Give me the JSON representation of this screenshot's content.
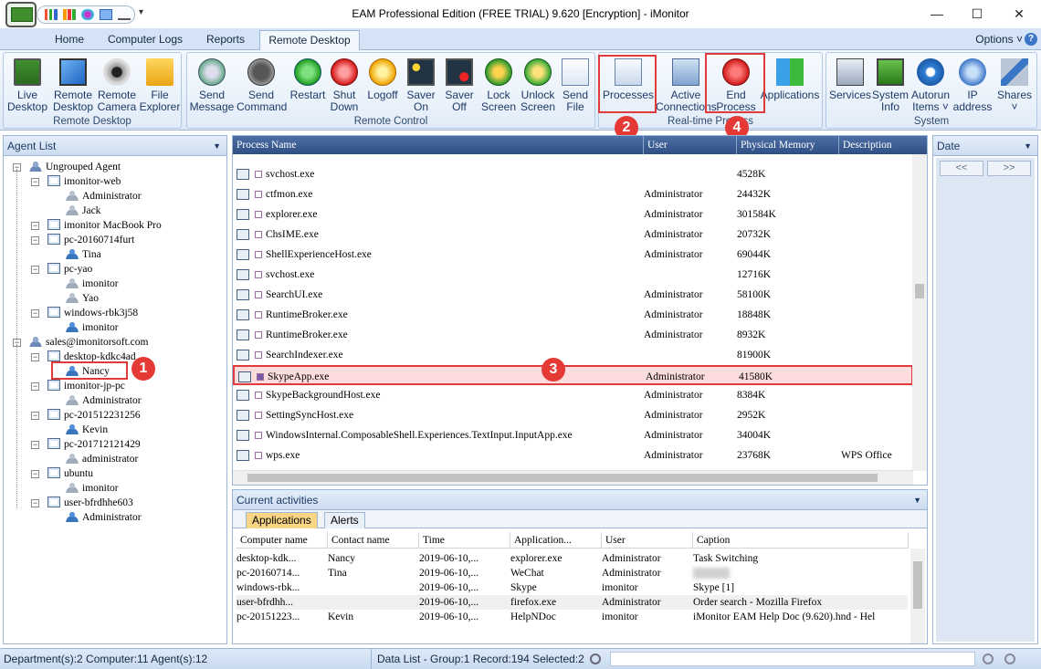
{
  "window": {
    "title": "EAM Professional Edition (FREE TRIAL) 9.620 [Encryption] - iMonitor",
    "min_glyph": "—",
    "max_glyph": "☐",
    "close_glyph": "✕",
    "qat_dropdown_glyph": "▾"
  },
  "tabs": [
    "Home",
    "Computer Logs",
    "Reports",
    "Remote Desktop"
  ],
  "active_tab": "Remote Desktop",
  "options_label": "Options ˅",
  "help_glyph": "?",
  "ribbon": {
    "groups": [
      {
        "label": "Remote Desktop",
        "buttons": [
          {
            "line1": "Live",
            "line2": "Desktop",
            "icon": "monitor-icon"
          },
          {
            "line1": "Remote",
            "line2": "Desktop",
            "icon": "remote-desktop-icon"
          },
          {
            "line1": "Remote",
            "line2": "Camera",
            "icon": "webcam-icon"
          },
          {
            "line1": "File",
            "line2": "Explorer",
            "icon": "folder-icon"
          }
        ]
      },
      {
        "label": "Remote Control",
        "buttons": [
          {
            "line1": "Send",
            "line2": "Message",
            "icon": "message-icon"
          },
          {
            "line1": "Send",
            "line2": "Command",
            "icon": "command-icon"
          },
          {
            "line1": "Restart",
            "line2": "",
            "icon": "restart-icon"
          },
          {
            "line1": "Shut",
            "line2": "Down",
            "icon": "power-icon"
          },
          {
            "line1": "Logoff",
            "line2": "",
            "icon": "key-icon"
          },
          {
            "line1": "Saver",
            "line2": "On",
            "icon": "screensaver-on-icon"
          },
          {
            "line1": "Saver",
            "line2": "Off",
            "icon": "screensaver-off-icon"
          },
          {
            "line1": "Lock",
            "line2": "Screen",
            "icon": "lock-screen-icon"
          },
          {
            "line1": "Unlock",
            "line2": "Screen",
            "icon": "unlock-screen-icon"
          },
          {
            "line1": "Send",
            "line2": "File",
            "icon": "send-file-icon"
          }
        ]
      },
      {
        "label": "Real-time Process",
        "buttons": [
          {
            "line1": "Processes",
            "line2": "",
            "icon": "processes-icon"
          },
          {
            "line1": "Active",
            "line2": "Connections",
            "icon": "connections-icon"
          },
          {
            "line1": "End",
            "line2": "Process",
            "icon": "end-process-icon"
          },
          {
            "line1": "Applications",
            "line2": "",
            "icon": "applications-icon"
          }
        ]
      },
      {
        "label": "System",
        "buttons": [
          {
            "line1": "Services",
            "line2": "",
            "icon": "services-icon"
          },
          {
            "line1": "System",
            "line2": "Info",
            "icon": "system-info-icon"
          },
          {
            "line1": "Autorun",
            "line2": "Items ˅",
            "icon": "autorun-icon"
          },
          {
            "line1": "IP",
            "line2": "address",
            "icon": "ip-icon"
          },
          {
            "line1": "Shares",
            "line2": "˅",
            "icon": "shares-icon"
          }
        ]
      }
    ]
  },
  "callouts": [
    "1",
    "2",
    "3",
    "4"
  ],
  "agent_list": {
    "title": "Agent List",
    "dropdown_glyph": "▼",
    "nodes": [
      {
        "label": "Ungrouped Agent",
        "type": "group",
        "level": 0
      },
      {
        "label": "imonitor-web",
        "type": "pc",
        "level": 1
      },
      {
        "label": "Administrator",
        "type": "userg",
        "level": 2
      },
      {
        "label": "Jack",
        "type": "userg",
        "level": 2
      },
      {
        "label": "imonitor  MacBook Pro",
        "type": "pc",
        "level": 1
      },
      {
        "label": "pc-20160714furt",
        "type": "pc",
        "level": 1
      },
      {
        "label": "Tina",
        "type": "user",
        "level": 2
      },
      {
        "label": "pc-yao",
        "type": "pc",
        "level": 1
      },
      {
        "label": "imonitor",
        "type": "userg",
        "level": 2
      },
      {
        "label": "Yao",
        "type": "userg",
        "level": 2
      },
      {
        "label": "windows-rbk3j58",
        "type": "pc",
        "level": 1
      },
      {
        "label": "imonitor",
        "type": "user",
        "level": 2
      },
      {
        "label": "sales@imonitorsoft.com",
        "type": "group",
        "level": 0
      },
      {
        "label": "desktop-kdkc4ad",
        "type": "pc",
        "level": 1
      },
      {
        "label": "Nancy",
        "type": "user",
        "level": 2
      },
      {
        "label": "imonitor-jp-pc",
        "type": "pc",
        "level": 1
      },
      {
        "label": "Administrator",
        "type": "userg",
        "level": 2
      },
      {
        "label": "pc-201512231256",
        "type": "pc",
        "level": 1
      },
      {
        "label": "Kevin",
        "type": "user",
        "level": 2
      },
      {
        "label": "pc-201712121429",
        "type": "pc",
        "level": 1
      },
      {
        "label": "administrator",
        "type": "userg",
        "level": 2
      },
      {
        "label": "ubuntu",
        "type": "pc",
        "level": 1
      },
      {
        "label": "imonitor",
        "type": "userg",
        "level": 2
      },
      {
        "label": "user-bfrdhhe603",
        "type": "pc",
        "level": 1
      },
      {
        "label": "Administrator",
        "type": "user",
        "level": 2
      }
    ]
  },
  "process_list": {
    "columns": [
      "Process Name",
      "User",
      "Physical Memory",
      "Description"
    ],
    "rows": [
      {
        "name": "svchost.exe",
        "user": "",
        "mem": "4528K",
        "desc": ""
      },
      {
        "name": "ctfmon.exe",
        "user": "Administrator",
        "mem": "24432K",
        "desc": ""
      },
      {
        "name": "explorer.exe",
        "user": "Administrator",
        "mem": "301584K",
        "desc": ""
      },
      {
        "name": "ChsIME.exe",
        "user": "Administrator",
        "mem": "20732K",
        "desc": ""
      },
      {
        "name": "ShellExperienceHost.exe",
        "user": "Administrator",
        "mem": "69044K",
        "desc": ""
      },
      {
        "name": "svchost.exe",
        "user": "",
        "mem": "12716K",
        "desc": ""
      },
      {
        "name": "SearchUI.exe",
        "user": "Administrator",
        "mem": "58100K",
        "desc": ""
      },
      {
        "name": "RuntimeBroker.exe",
        "user": "Administrator",
        "mem": "18848K",
        "desc": ""
      },
      {
        "name": "RuntimeBroker.exe",
        "user": "Administrator",
        "mem": "8932K",
        "desc": ""
      },
      {
        "name": "SearchIndexer.exe",
        "user": "",
        "mem": "81900K",
        "desc": ""
      },
      {
        "name": "SkypeApp.exe",
        "user": "Administrator",
        "mem": "41580K",
        "desc": "",
        "selected": true
      },
      {
        "name": "SkypeBackgroundHost.exe",
        "user": "Administrator",
        "mem": "8384K",
        "desc": ""
      },
      {
        "name": "SettingSyncHost.exe",
        "user": "Administrator",
        "mem": "2952K",
        "desc": ""
      },
      {
        "name": "WindowsInternal.ComposableShell.Experiences.TextInput.InputApp.exe",
        "user": "Administrator",
        "mem": "34004K",
        "desc": ""
      },
      {
        "name": "wps.exe",
        "user": "Administrator",
        "mem": "23768K",
        "desc": "WPS Office"
      }
    ]
  },
  "date_panel": {
    "title": "Date",
    "prev": "<<",
    "next": ">>"
  },
  "activities": {
    "title": "Current activities",
    "tabs": [
      "Applications",
      "Alerts"
    ],
    "columns": [
      "Computer name",
      "Contact name",
      "Time",
      "Application...",
      "User",
      "Caption"
    ],
    "rows": [
      {
        "computer": "desktop-kdk...",
        "contact": "Nancy",
        "time": "2019-06-10,...",
        "app": "explorer.exe",
        "user": "Administrator",
        "caption": "Task Switching"
      },
      {
        "computer": "pc-20160714...",
        "contact": "Tina",
        "time": "2019-06-10,...",
        "app": "WeChat",
        "user": "Administrator",
        "caption": ""
      },
      {
        "computer": "windows-rbk...",
        "contact": "",
        "time": "2019-06-10,...",
        "app": "Skype",
        "user": "imonitor",
        "caption": "Skype [1]"
      },
      {
        "computer": "user-bfrdhh...",
        "contact": "",
        "time": "2019-06-10,...",
        "app": "firefox.exe",
        "user": "Administrator",
        "caption": "Order search - Mozilla Firefox"
      },
      {
        "computer": "pc-20151223...",
        "contact": "Kevin",
        "time": "2019-06-10,...",
        "app": "HelpNDoc",
        "user": "imonitor",
        "caption": "iMonitor EAM Help Doc (9.620).hnd - Hel"
      }
    ]
  },
  "status": {
    "left": "Department(s):2  Computer:11  Agent(s):12",
    "right": "Data List - Group:1  Record:194  Selected:2"
  },
  "colors": {
    "highlight": "#e03a3a",
    "ribbon_bg": "#dde9f7",
    "header_blue": "#2f4f84"
  }
}
